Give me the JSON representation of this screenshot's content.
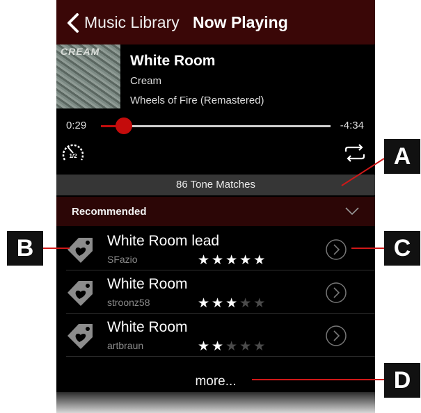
{
  "nav": {
    "back_label": "Music Library",
    "title": "Now Playing"
  },
  "track": {
    "album_art_text": "CREAM",
    "title": "White Room",
    "artist": "Cream",
    "album": "Wheels of Fire (Remastered)",
    "elapsed": "0:29",
    "remaining": "-4:34",
    "progress": 0.1
  },
  "controls": {
    "speed_label": "1/2",
    "speed_icon": "half-speed-icon",
    "repeat_icon": "repeat-icon"
  },
  "tone_matches": "86 Tone Matches",
  "recommended": {
    "label": "Recommended",
    "items": [
      {
        "title": "White Room lead",
        "user": "SFazio",
        "rating": 5
      },
      {
        "title": "White Room",
        "user": "stroonz58",
        "rating": 3
      },
      {
        "title": "White Room",
        "user": "artbraun",
        "rating": 2
      }
    ],
    "more_label": "more..."
  },
  "callouts": {
    "a": "A",
    "b": "B",
    "c": "C",
    "d": "D"
  },
  "colors": {
    "accent": "#c40c0c",
    "nav_bg": "#3a0707",
    "header_bg": "#2c0606"
  }
}
